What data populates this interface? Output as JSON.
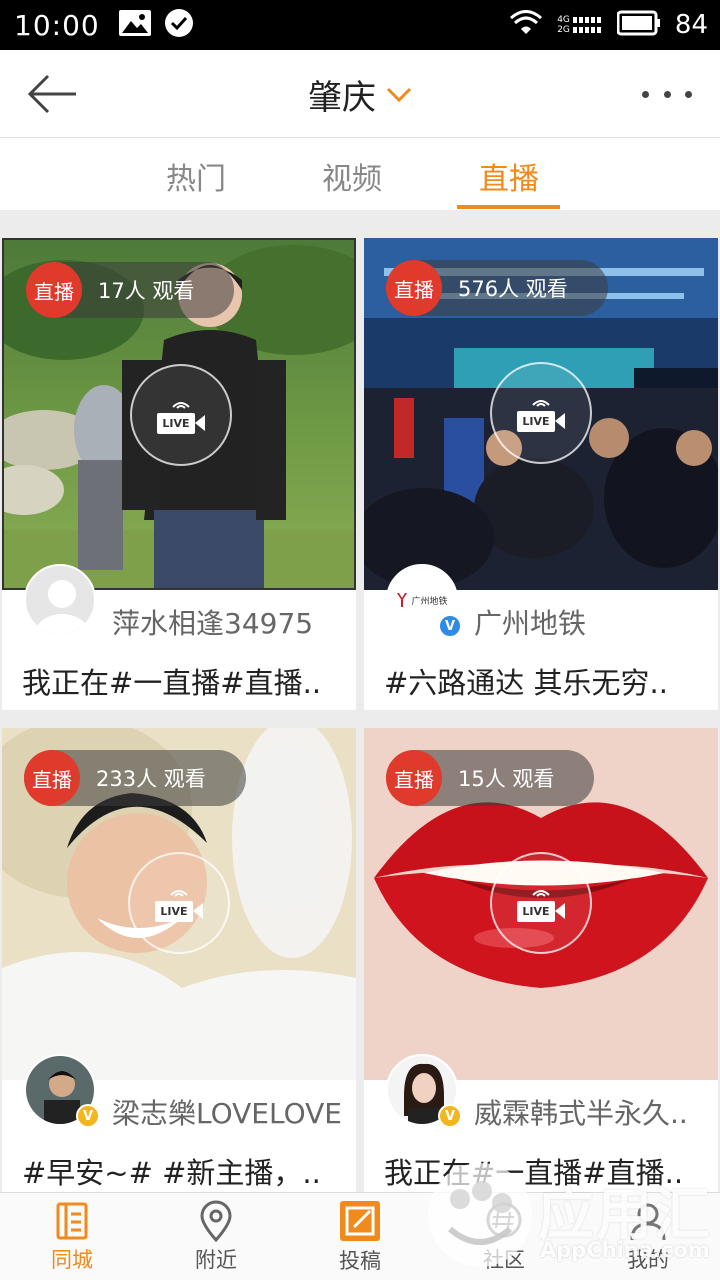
{
  "status_bar": {
    "time": "10:00",
    "battery": "84",
    "network_top": "4G",
    "network_bottom": "2G"
  },
  "header": {
    "city": "肇庆"
  },
  "tabs": [
    {
      "label": "热门"
    },
    {
      "label": "视频"
    },
    {
      "label": "直播"
    }
  ],
  "active_tab": "直播",
  "cards": [
    {
      "badge": "直播",
      "viewers": "17人 观看",
      "author": "萍水相逢34975",
      "caption": "我正在#一直播#直播..",
      "verified": ""
    },
    {
      "badge": "直播",
      "viewers": "576人 观看",
      "author": "广州地铁",
      "caption": "#六路通达  其乐无穷..",
      "verified": "V"
    },
    {
      "badge": "直播",
      "viewers": "233人 观看",
      "author": "梁志樂LOVELOVE",
      "caption": "#早安~#  #新主播，..",
      "verified": "V"
    },
    {
      "badge": "直播",
      "viewers": "15人 观看",
      "author": "威霖韩式半永久..",
      "caption": "我正在#一直播#直播..",
      "verified": "V"
    }
  ],
  "live_icon_text": "LIVE",
  "metro_logo_text": "广州地铁",
  "bottom_nav": [
    {
      "label": "同城",
      "icon": "city-icon"
    },
    {
      "label": "附近",
      "icon": "location-pin-icon"
    },
    {
      "label": "投稿",
      "icon": "compose-icon"
    },
    {
      "label": "社区",
      "icon": "community-icon"
    },
    {
      "label": "我的",
      "icon": "profile-icon"
    }
  ],
  "watermark": {
    "text": "应用汇",
    "sub": "AppChina.com"
  },
  "colors": {
    "accent": "#f08a1c",
    "live_red": "#e03a2c",
    "verified_blue": "#2e8be6",
    "verified_gold": "#f2b71f"
  }
}
